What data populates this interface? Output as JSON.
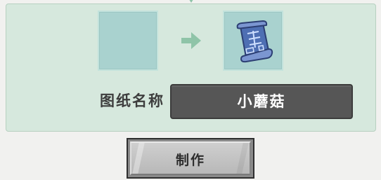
{
  "crafting": {
    "name_label": "图纸名称",
    "name_value": "小蘑菇",
    "input_slot": {
      "empty": true
    },
    "output_slot": {
      "item_icon": "blueprint-scroll-icon"
    },
    "flow_icon": "arrow-right-icon",
    "craft_button_label": "制作"
  },
  "colors": {
    "panel_bg": "#d6e8dd",
    "slot_bg": "#a9d2cf",
    "arrow": "#8fc4a8",
    "field_bg": "#565656",
    "button_face": "#c4c4c4"
  }
}
